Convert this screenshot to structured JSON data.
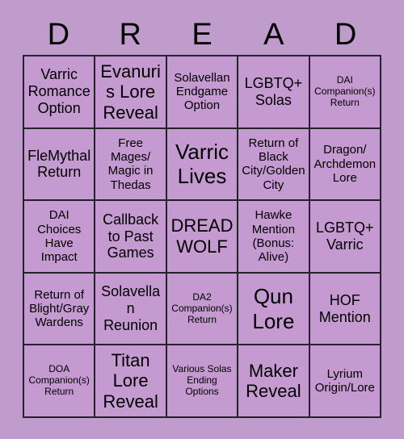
{
  "card": {
    "title_letters": [
      "D",
      "R",
      "E",
      "A",
      "D"
    ],
    "background_color": "#c09ccc",
    "cell_color": "#c49ad0",
    "border_color": "#26222b",
    "text_color": "#000000"
  },
  "grid": {
    "columns": 5,
    "rows": 5,
    "cells": [
      {
        "text": "Varric Romance Option",
        "size": "md"
      },
      {
        "text": "Evanuris Lore Reveal",
        "size": "lg"
      },
      {
        "text": "Solavellan Endgame Option",
        "size": "sm"
      },
      {
        "text": "LGBTQ+ Solas",
        "size": "md"
      },
      {
        "text": "DAI Companion(s) Return",
        "size": "xs"
      },
      {
        "text": "FleMythal Return",
        "size": "md"
      },
      {
        "text": "Free Mages/ Magic in Thedas",
        "size": "sm"
      },
      {
        "text": "Varric Lives",
        "size": "xl"
      },
      {
        "text": "Return of Black City/Golden City",
        "size": "sm"
      },
      {
        "text": "Dragon/ Archdemon Lore",
        "size": "sm"
      },
      {
        "text": "DAI Choices Have Impact",
        "size": "sm"
      },
      {
        "text": "Callback to Past Games",
        "size": "md"
      },
      {
        "text": "DREAD WOLF",
        "size": "lg"
      },
      {
        "text": "Hawke Mention (Bonus: Alive)",
        "size": "sm"
      },
      {
        "text": "LGBTQ+ Varric",
        "size": "md"
      },
      {
        "text": "Return of Blight/Gray Wardens",
        "size": "sm"
      },
      {
        "text": "Solavellan Reunion",
        "size": "md"
      },
      {
        "text": "DA2 Companion(s) Return",
        "size": "xs"
      },
      {
        "text": "Qun Lore",
        "size": "xl"
      },
      {
        "text": "HOF Mention",
        "size": "md"
      },
      {
        "text": "DOA Companion(s) Return",
        "size": "xs"
      },
      {
        "text": "Titan Lore Reveal",
        "size": "lg"
      },
      {
        "text": "Various Solas Ending Options",
        "size": "xs"
      },
      {
        "text": "Maker Reveal",
        "size": "lg"
      },
      {
        "text": "Lyrium Origin/Lore",
        "size": "sm"
      }
    ]
  }
}
